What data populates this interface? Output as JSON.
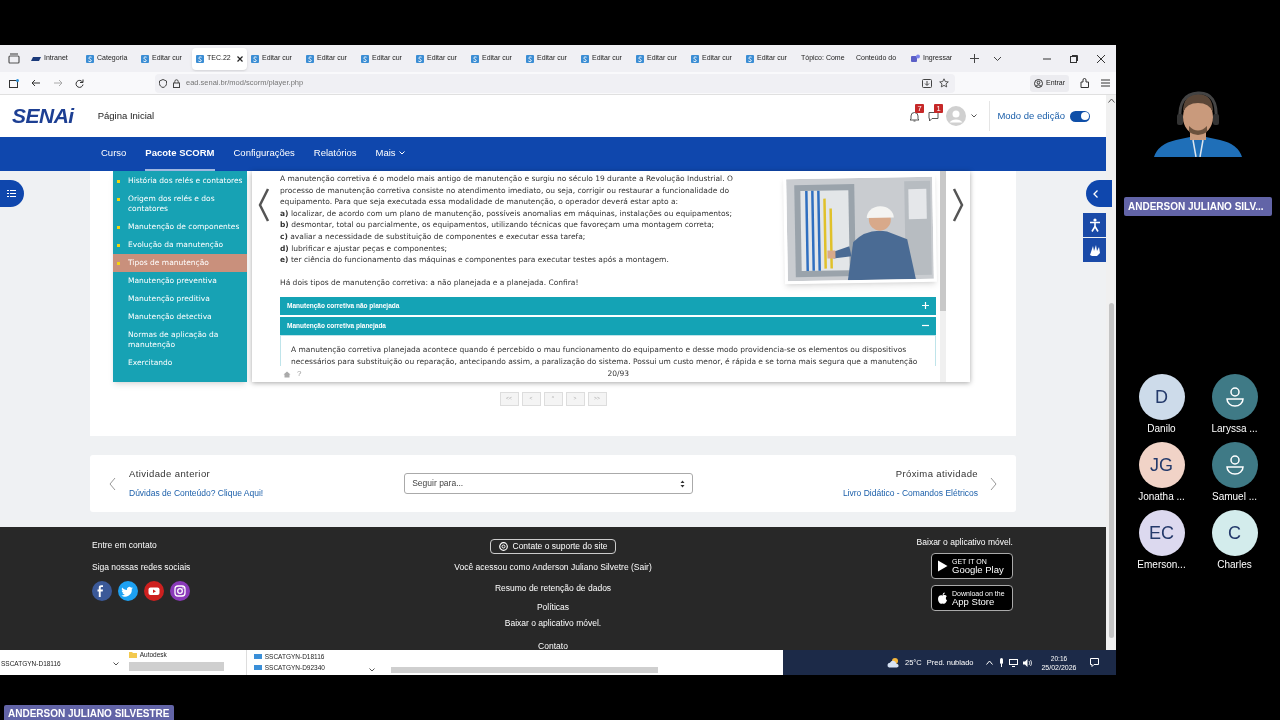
{
  "browser": {
    "tabs": [
      {
        "label": "Intranet",
        "kind": "intranet",
        "selected": false
      },
      {
        "label": "Categoria",
        "kind": "senai",
        "selected": false
      },
      {
        "label": "Editar cur",
        "kind": "senai",
        "selected": false
      },
      {
        "label": "TEC.22",
        "kind": "senai",
        "selected": true
      },
      {
        "label": "Editar cur",
        "kind": "senai",
        "selected": false
      },
      {
        "label": "Editar cur",
        "kind": "senai",
        "selected": false
      },
      {
        "label": "Editar cur",
        "kind": "senai",
        "selected": false
      },
      {
        "label": "Editar cur",
        "kind": "senai",
        "selected": false
      },
      {
        "label": "Editar cur",
        "kind": "senai",
        "selected": false
      },
      {
        "label": "Editar cur",
        "kind": "senai",
        "selected": false
      },
      {
        "label": "Editar cur",
        "kind": "senai",
        "selected": false
      },
      {
        "label": "Editar cur",
        "kind": "senai",
        "selected": false
      },
      {
        "label": "Editar cur",
        "kind": "senai",
        "selected": false
      },
      {
        "label": "Editar cur",
        "kind": "senai",
        "selected": false
      },
      {
        "label": "Tópico: Come",
        "kind": "plain",
        "selected": false
      },
      {
        "label": "Conteúdo do",
        "kind": "plain",
        "selected": false
      },
      {
        "label": "Ingressar",
        "kind": "teams",
        "selected": false
      }
    ],
    "url": "ead.senai.br/mod/scorm/player.php",
    "sign_in_button": "Entrar"
  },
  "site": {
    "logo": "SENAi",
    "home_link": "Página Inicial",
    "notifications_count": "7",
    "messages_count": "1",
    "editing_mode": {
      "label": "Modo de edição",
      "on": true
    },
    "nav": [
      {
        "label": "Curso",
        "selected": false,
        "dropdown": false
      },
      {
        "label": "Pacote SCORM",
        "selected": true,
        "dropdown": false
      },
      {
        "label": "Configurações",
        "selected": false,
        "dropdown": false
      },
      {
        "label": "Relatórios",
        "selected": false,
        "dropdown": false
      },
      {
        "label": "Mais",
        "selected": false,
        "dropdown": true
      }
    ]
  },
  "scorm": {
    "toc": [
      {
        "label": "História dos relés e contatores",
        "visited": true,
        "selected": false
      },
      {
        "label": "Origem dos relés e dos contatores",
        "visited": true,
        "selected": false
      },
      {
        "label": "Manutenção de componentes",
        "visited": true,
        "selected": false
      },
      {
        "label": "Evolução da manutenção",
        "visited": true,
        "selected": false
      },
      {
        "label": "Tipos de manutenção",
        "visited": true,
        "selected": true
      },
      {
        "label": "Manutenção preventiva",
        "visited": false,
        "selected": false
      },
      {
        "label": "Manutenção preditiva",
        "visited": false,
        "selected": false
      },
      {
        "label": "Manutenção detectiva",
        "visited": false,
        "selected": false
      },
      {
        "label": "Normas de aplicação da manutenção",
        "visited": false,
        "selected": false
      },
      {
        "label": "Exercitando",
        "visited": false,
        "selected": false
      }
    ],
    "intro": "A manutenção corretiva é o modelo mais antigo de manutenção e surgiu no século 19 durante a Revolução Industrial. O processo de manutenção corretiva consiste no atendimento imediato, ou seja, corrigir ou restaurar a funcionalidade do equipamento. Para que seja executada essa modalidade de manutenção, o operador deverá estar apto a:",
    "steps": [
      "**a)** localizar, de acordo com um plano de manutenção, possíveis anomalias em máquinas, instalações ou equipamentos;",
      "**b)** desmontar, total ou parcialmente, os equipamentos, utilizando técnicas que favoreçam uma montagem correta;",
      "**c)** avaliar a necessidade de substituição de componentes e executar essa tarefa;",
      "**d)** lubrificar e ajustar peças e componentes;",
      "**e)** ter ciência do funcionamento das máquinas e componentes para executar testes após a montagem."
    ],
    "closing": "Há dois tipos de manutenção corretiva: a não planejada e a planejada. Confira!",
    "accordion": [
      {
        "title": "Manutenção corretiva não planejada",
        "expanded": false
      },
      {
        "title": "Manutenção corretiva planejada",
        "expanded": true,
        "body": "A manutenção corretiva planejada acontece quando é percebido o mau funcionamento do equipamento e desse modo providencia-se os elementos ou dispositivos necessários para substituição ou reparação, antecipando assim, a paralização do sistema. Possui um custo menor, é rápida e se torna mais segura que a manutenção"
      }
    ],
    "help_mark": "?",
    "page_counter": "20/93",
    "nav_buttons": [
      "<<",
      "<",
      "^",
      ">",
      ">>"
    ]
  },
  "activity_nav": {
    "previous_label": "Atividade anterior",
    "previous_link": "Dúvidas de Conteúdo? Clique Aqui!",
    "jump_placeholder": "Seguir para...",
    "next_label": "Próxima atividade",
    "next_link": "Livro Didático - Comandos Elétricos"
  },
  "footer": {
    "contact": "Entre em contato",
    "social_label": "Siga nossas redes sociais",
    "social": [
      {
        "kind": "facebook",
        "color": "#3b5998"
      },
      {
        "kind": "twitter",
        "color": "#1da1f2"
      },
      {
        "kind": "youtube",
        "color": "#cd201f"
      },
      {
        "kind": "instagram",
        "color": "#8a3ab9"
      }
    ],
    "support_button": "Contate o suporte do site",
    "logged_in": "Você acessou como Anderson Juliano Silvetre (Sair)",
    "links": [
      "Resumo de retenção de dados",
      "Políticas",
      "Baixar o aplicativo móvel.",
      "Contato"
    ],
    "app_label": "Baixar o aplicativo móvel.",
    "stores": [
      {
        "kind": "google",
        "small": "GET IT ON",
        "big": "Google Play"
      },
      {
        "kind": "apple",
        "small": "Download on the",
        "big": "App Store"
      }
    ]
  },
  "taskbar": {
    "host_label": "SSCATGYN-D18116",
    "folder": "Autodesk",
    "computers": [
      "SSCATGYN-D18116",
      "SSCATGYN-D92340"
    ],
    "temperature": "25°C",
    "weather": "Pred. nublado",
    "time": "20:16",
    "date": "25/02/2026"
  },
  "meeting": {
    "video_name_tag": "ANDERSON JULIANO SILV...",
    "presenter_name_tag": "ANDERSON JULIANO SILVESTRE",
    "participants": [
      {
        "name": "Danilo",
        "kind": "initials",
        "initials": "D",
        "color": "#cddbea"
      },
      {
        "name": "Laryssa ...",
        "kind": "avatar",
        "color": "#3f7a86"
      },
      {
        "name": "Jonatha ...",
        "kind": "initials",
        "initials": "JG",
        "color": "#f1d3c7"
      },
      {
        "name": "Samuel ...",
        "kind": "avatar",
        "color": "#3f7a86"
      },
      {
        "name": "Emerson...",
        "kind": "initials",
        "initials": "EC",
        "color": "#dcd9ef"
      },
      {
        "name": "Charles",
        "kind": "initials",
        "initials": "C",
        "color": "#d3ecec"
      }
    ]
  }
}
